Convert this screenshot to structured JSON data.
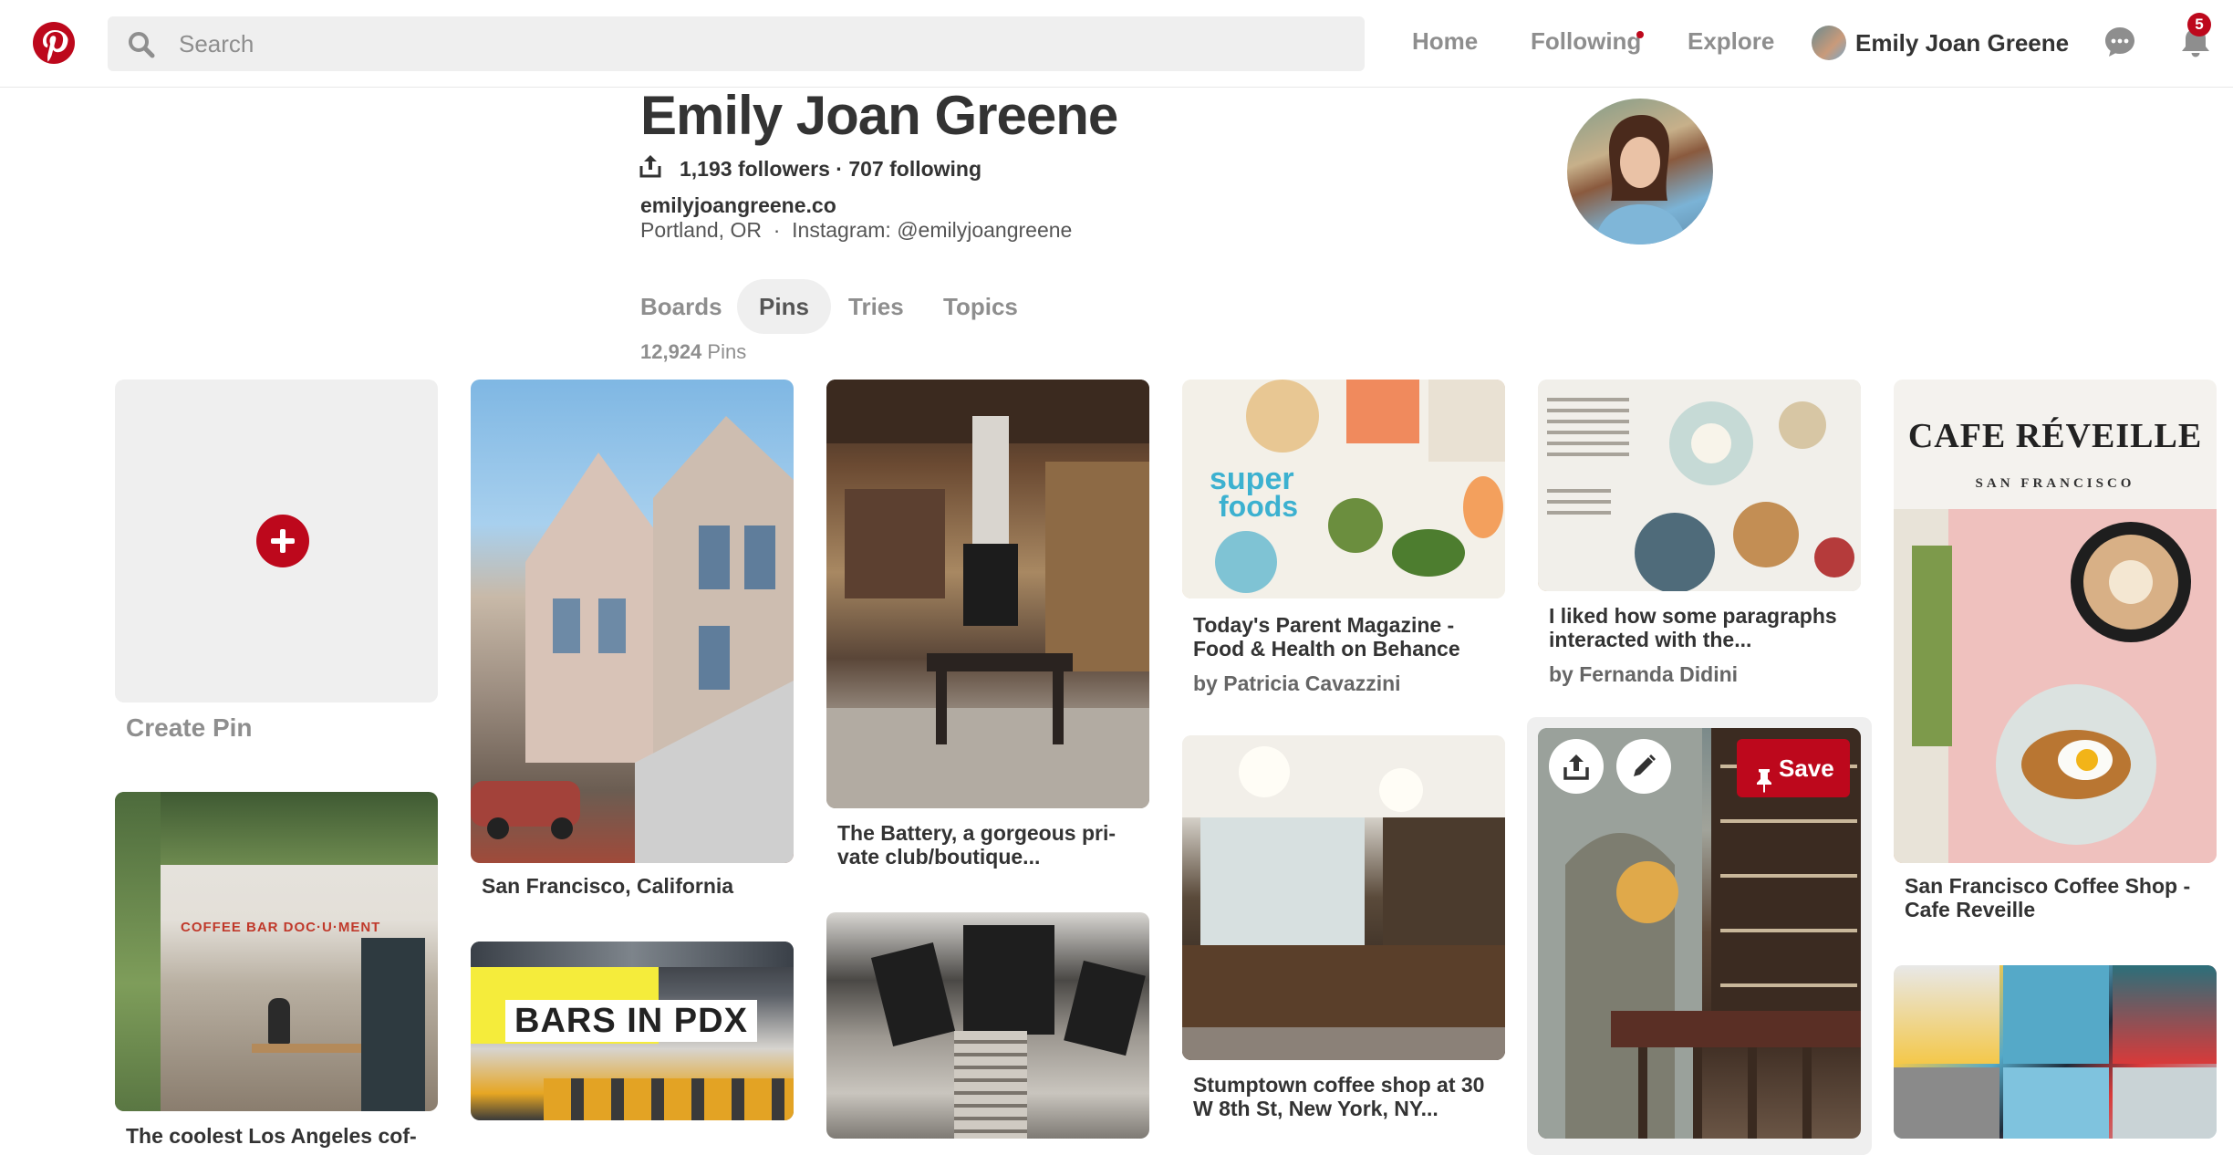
{
  "header": {
    "search_placeholder": "Search",
    "nav": [
      "Home",
      "Following",
      "Explore"
    ],
    "user_name": "Emily Joan Greene",
    "notification_count": "5"
  },
  "profile": {
    "name": "Emily Joan Greene",
    "stats": "1,193 followers · 707 following",
    "website": "emilyjoangreene.co",
    "location_line": "Portland, OR  ·  Instagram: @emilyjoangreene"
  },
  "tabs": {
    "items": [
      "Boards",
      "Pins",
      "Tries",
      "Topics"
    ],
    "active": "Pins"
  },
  "pin_count": {
    "number": "12,924",
    "label": " Pins"
  },
  "create_pin_label": "Create Pin",
  "hover_pin": {
    "save_label": "Save"
  },
  "pins": [
    {
      "caption": "The coolest Los Angeles cof-",
      "image_text": "COFFEE BAR  DOC·U·MENT"
    },
    {
      "caption": "San Francisco, California"
    },
    {
      "image_text": "BARS IN PDX"
    },
    {
      "caption": "The Battery, a gorgeous pri-\nvate club/boutique..."
    },
    {
      "caption": "Today's Parent Magazine -\nFood & Health on Behance",
      "by": "by Patricia Cavazzini"
    },
    {
      "caption": "Stumptown coffee shop at 30\nW 8th St, New York, NY..."
    },
    {
      "caption": "I liked how some paragraphs\ninteracted with the...",
      "by": "by Fernanda Didini"
    },
    {
      "caption": "San Francisco Coffee Shop -\nCafe Reveille",
      "image_title": "CAFE RÉVEILLE",
      "image_subtitle": "SAN FRANCISCO"
    }
  ],
  "colors": {
    "brand_red": "#bd081c",
    "search_bg": "#efefef",
    "muted_text": "#8e8e8e",
    "main_text": "#333333"
  },
  "icons": [
    "pinterest-logo-icon",
    "search-icon",
    "chat-icon",
    "bell-icon",
    "share-icon",
    "edit-icon",
    "pushpin-icon",
    "plus-icon"
  ]
}
